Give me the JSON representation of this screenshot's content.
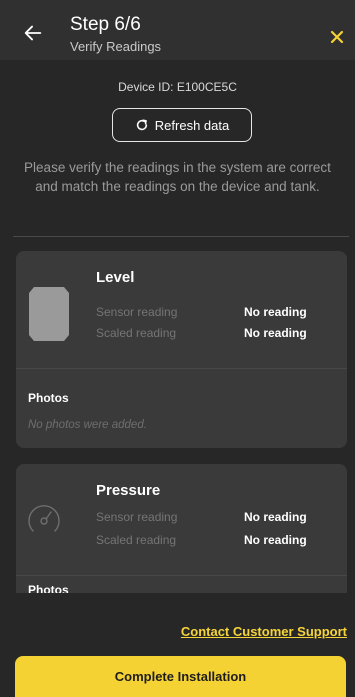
{
  "header": {
    "step": "Step 6/6",
    "subtitle": "Verify Readings",
    "back_icon": "arrow-left-icon",
    "close_icon": "close-icon",
    "accent": "#f5d234"
  },
  "device": {
    "id_text": "Device ID: E100CE5C"
  },
  "refresh": {
    "label": "Refresh data",
    "icon": "refresh-icon"
  },
  "instructions": "Please verify the readings in the system are correct and match the readings on the device and tank.",
  "cards": [
    {
      "title": "Level",
      "icon": "tank-icon",
      "sensor_label": "Sensor reading",
      "sensor_value": "No reading",
      "scaled_label": "Scaled reading",
      "scaled_value": "No reading",
      "photos_label": "Photos",
      "no_photos": "No photos were added."
    },
    {
      "title": "Pressure",
      "icon": "gauge-icon",
      "sensor_label": "Sensor reading",
      "sensor_value": "No reading",
      "scaled_label": "Scaled reading",
      "scaled_value": "No reading",
      "photos_label": "Photos"
    }
  ],
  "support_link": "Contact Customer Support",
  "complete_button": "Complete Installation"
}
